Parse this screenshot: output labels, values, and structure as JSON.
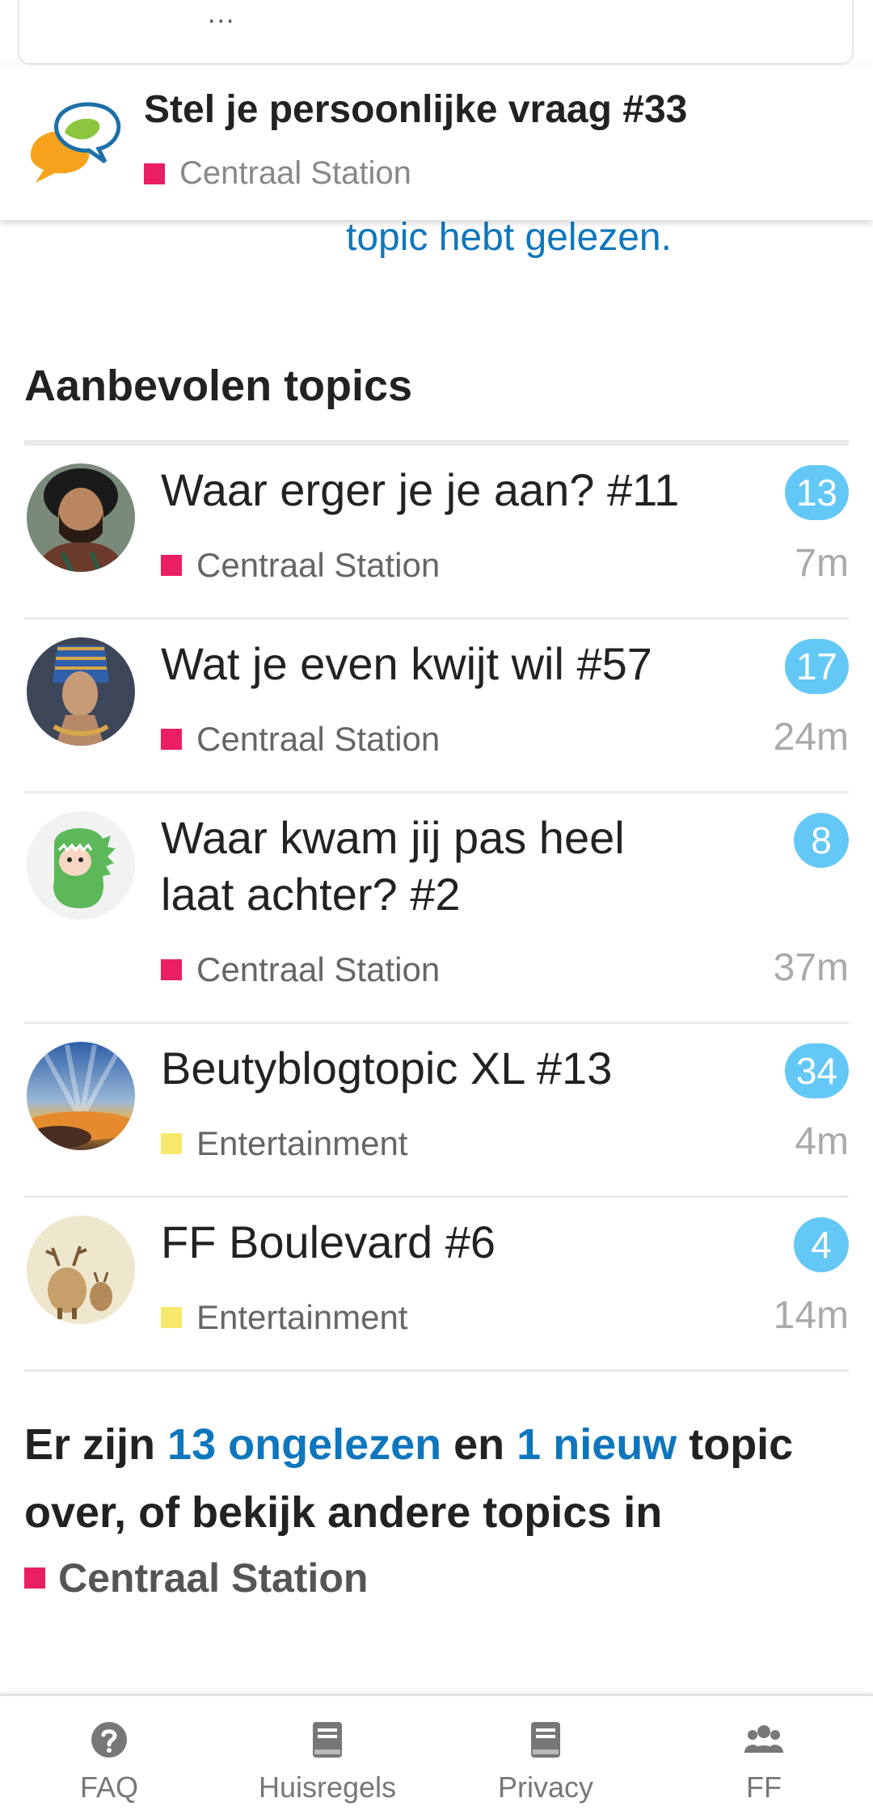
{
  "top_card": {
    "ellipsis": "..."
  },
  "header": {
    "title": "Stel je persoonlijke vraag #33",
    "category": "Centraal Station",
    "category_color": "#e91e63"
  },
  "scroll_link": "topic hebt gelezen.",
  "section_title": "Aanbevolen topics",
  "topics": [
    {
      "title": "Waar erger je je aan? #11",
      "category": "Centraal Station",
      "category_color": "#e91e63",
      "unread": "13",
      "age": "7m",
      "avatar": "man-curly-hair-avatar"
    },
    {
      "title": "Wat je even kwijt wil #57",
      "category": "Centraal Station",
      "category_color": "#e91e63",
      "unread": "17",
      "age": "24m",
      "avatar": "nefertiti-avatar"
    },
    {
      "title": "Waar kwam jij pas heel laat achter? #2",
      "category": "Centraal Station",
      "category_color": "#e91e63",
      "unread": "8",
      "age": "37m",
      "avatar": "dino-costume-avatar"
    },
    {
      "title": "Beutyblogtopic XL #13",
      "category": "Entertainment",
      "category_color": "#f7e96b",
      "unread": "34",
      "age": "4m",
      "avatar": "sunset-sky-avatar"
    },
    {
      "title": "FF Boulevard #6",
      "category": "Entertainment",
      "category_color": "#f7e96b",
      "unread": "4",
      "age": "14m",
      "avatar": "reindeer-avatar"
    }
  ],
  "footer": {
    "prefix": "Er zijn ",
    "unread_link": "13 ongelezen",
    "middle": " en ",
    "new_link": "1 nieuw",
    "suffix": " topic over, of bekijk andere topics in",
    "category": "Centraal Station",
    "category_color": "#e91e63"
  },
  "nav": [
    {
      "label": "FAQ",
      "icon": "question-circle-icon"
    },
    {
      "label": "Huisregels",
      "icon": "book-icon"
    },
    {
      "label": "Privacy",
      "icon": "book-icon"
    },
    {
      "label": "FF",
      "icon": "users-icon"
    }
  ],
  "colors": {
    "link": "#0e76bd",
    "badge": "#64c8f7"
  }
}
